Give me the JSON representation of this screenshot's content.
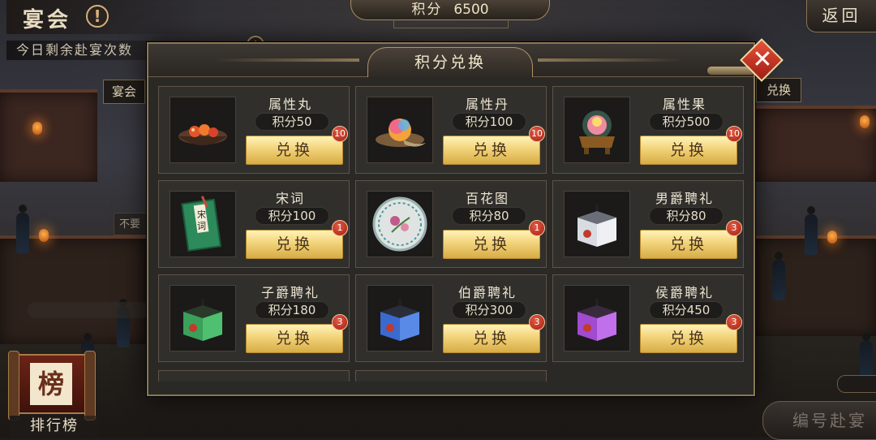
{
  "header": {
    "title": "宴会",
    "remaining_text": "今日剩余赴宴次数",
    "score_label": "积分",
    "score_value": "6500",
    "return_label": "返回"
  },
  "background_labels": {
    "left_tab": "宴会",
    "right_tab": "兑换",
    "left_faded": "不要"
  },
  "modal": {
    "title": "积分兑换",
    "close_icon": "close-x-icon",
    "items": [
      {
        "name": "属性丸",
        "cost": "积分50",
        "button": "兑换",
        "badge": "10",
        "icon": "pills-bowl-icon"
      },
      {
        "name": "属性丹",
        "cost": "积分100",
        "button": "兑换",
        "badge": "10",
        "icon": "elixir-icon"
      },
      {
        "name": "属性果",
        "cost": "积分500",
        "button": "兑换",
        "badge": "10",
        "icon": "fruit-censer-icon"
      },
      {
        "name": "宋词",
        "cost": "积分100",
        "button": "兑换",
        "badge": "1",
        "icon": "book-icon",
        "book_text": "宋词"
      },
      {
        "name": "百花图",
        "cost": "积分80",
        "button": "兑换",
        "badge": "1",
        "icon": "flower-plate-icon"
      },
      {
        "name": "男爵聘礼",
        "cost": "积分80",
        "button": "兑换",
        "badge": "3",
        "icon": "gift-box-white-icon"
      },
      {
        "name": "子爵聘礼",
        "cost": "积分180",
        "button": "兑换",
        "badge": "3",
        "icon": "gift-box-green-icon"
      },
      {
        "name": "伯爵聘礼",
        "cost": "积分300",
        "button": "兑换",
        "badge": "3",
        "icon": "gift-box-blue-icon"
      },
      {
        "name": "侯爵聘礼",
        "cost": "积分450",
        "button": "兑换",
        "badge": "3",
        "icon": "gift-box-purple-icon"
      }
    ]
  },
  "ranking": {
    "icon_text": "榜",
    "label": "排行榜"
  },
  "bottom_button": "编号赴宴",
  "colors": {
    "accent_gold": "#f2d37a",
    "badge_red": "#c23620",
    "frame": "#8b7755"
  }
}
